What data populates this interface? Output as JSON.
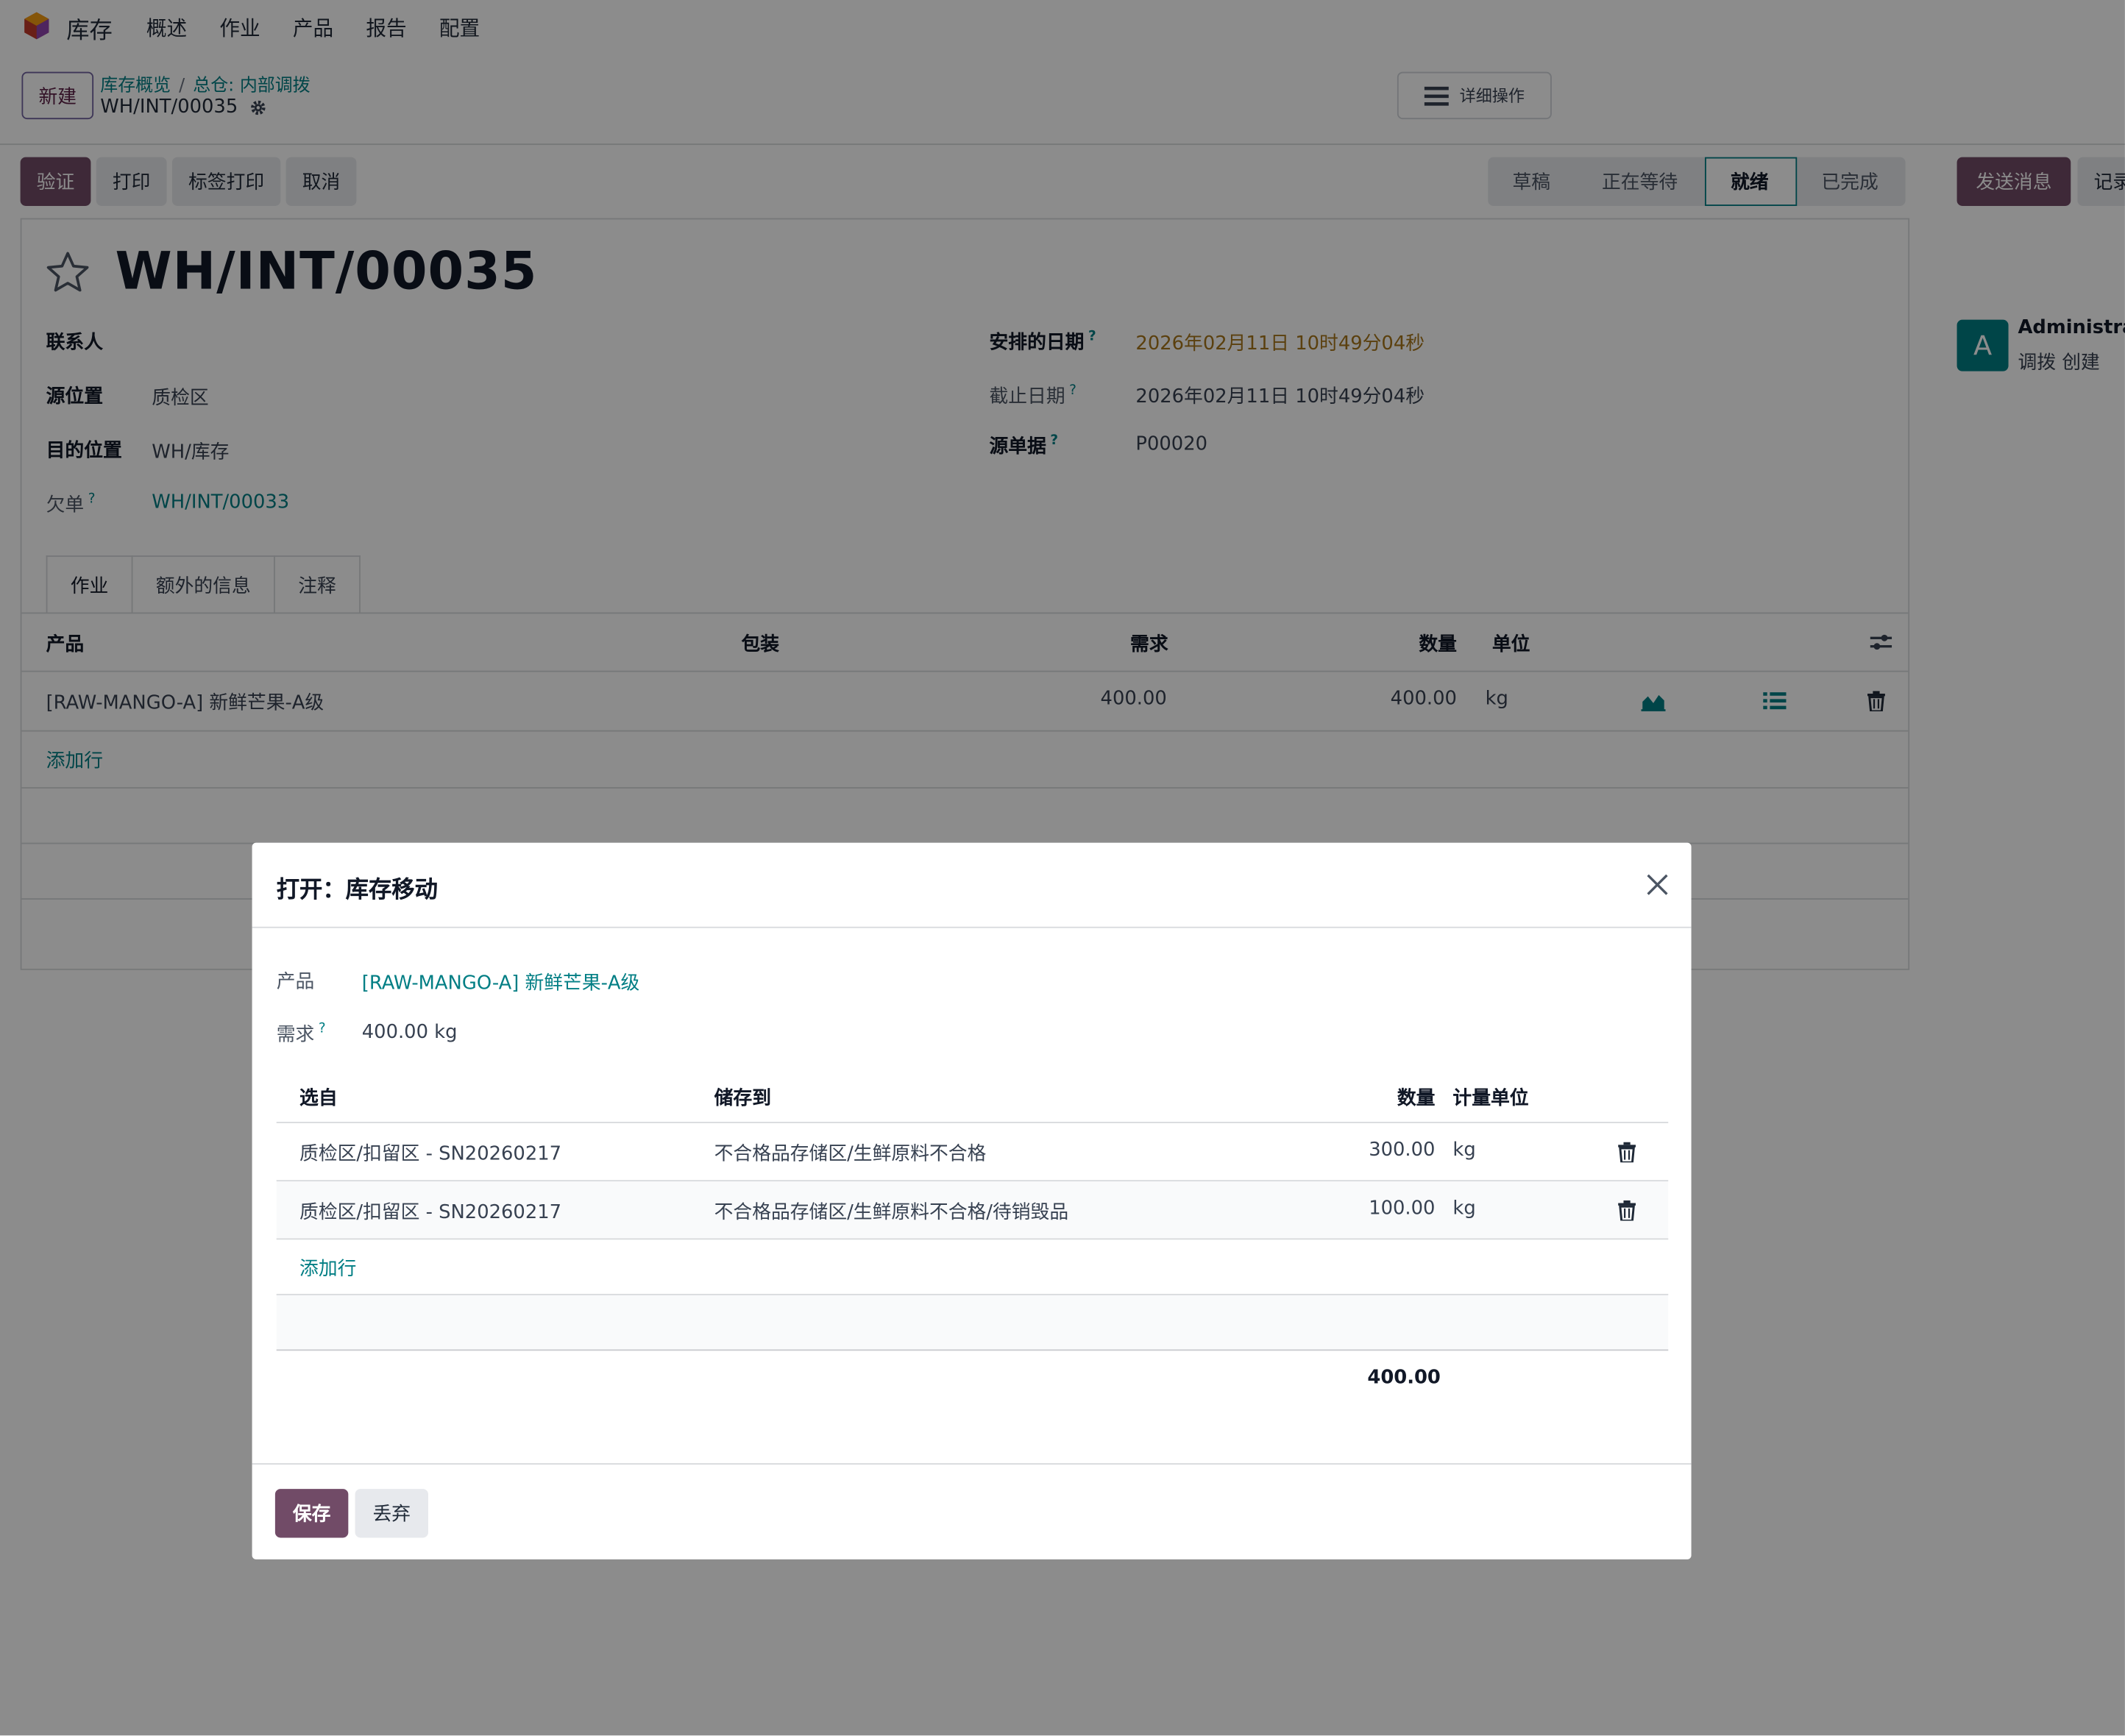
{
  "nav": {
    "app_name": "库存",
    "menu": [
      "概述",
      "作业",
      "产品",
      "报告",
      "配置"
    ]
  },
  "control": {
    "new_label": "新建",
    "breadcrumb": [
      "库存概览",
      "总仓: 内部调拨"
    ],
    "breadcrumb_sep": "/",
    "record_name": "WH/INT/00035",
    "actions_label": "详细操作"
  },
  "actionbar": {
    "validate": "验证",
    "print": "打印",
    "label_print": "标签打印",
    "cancel": "取消"
  },
  "status": {
    "steps": [
      "草稿",
      "正在等待",
      "就绪",
      "已完成"
    ],
    "active": "就绪"
  },
  "chatter": {
    "send_message": "发送消息",
    "log_note": "记录",
    "avatar_letter": "A",
    "author": "Administrator",
    "message": "调拨 创建"
  },
  "form": {
    "title": "WH/INT/00035",
    "contact_label": "联系人",
    "source_location_label": "源位置",
    "source_location": "质检区",
    "dest_location_label": "目的位置",
    "dest_location": "WH/库存",
    "backorder_label": "欠单",
    "backorder": "WH/INT/00033",
    "scheduled_label": "安排的日期",
    "scheduled": "2026年02月11日 10时49分04秒",
    "deadline_label": "截止日期",
    "deadline": "2026年02月11日 10时49分04秒",
    "source_doc_label": "源单据",
    "source_doc": "P00020",
    "help_mark": "?"
  },
  "tabs": [
    "作业",
    "额外的信息",
    "注释"
  ],
  "moves": {
    "headers": {
      "product": "产品",
      "packaging": "包装",
      "demand": "需求",
      "quantity": "数量",
      "uom": "单位"
    },
    "rows": [
      {
        "product": "[RAW-MANGO-A] 新鲜芒果-A级",
        "demand": "400.00",
        "quantity": "400.00",
        "uom": "kg"
      }
    ],
    "add_line": "添加行"
  },
  "modal": {
    "title": "打开：库存移动",
    "product_label": "产品",
    "product": "[RAW-MANGO-A] 新鲜芒果-A级",
    "demand_label": "需求",
    "demand": "400.00 kg",
    "headers": {
      "from": "选自",
      "to": "储存到",
      "quantity": "数量",
      "uom": "计量单位"
    },
    "rows": [
      {
        "from": "质检区/扣留区 - SN20260217",
        "to": "不合格品存储区/生鲜原料不合格",
        "quantity": "300.00",
        "uom": "kg"
      },
      {
        "from": "质检区/扣留区 - SN20260217",
        "to": "不合格品存储区/生鲜原料不合格/待销毁品",
        "quantity": "100.00",
        "uom": "kg"
      }
    ],
    "add_line": "添加行",
    "total": "400.00",
    "save": "保存",
    "discard": "丢弃"
  },
  "colors": {
    "primary": "#714b67",
    "link": "#017e84",
    "warning_date": "#a7761a"
  }
}
